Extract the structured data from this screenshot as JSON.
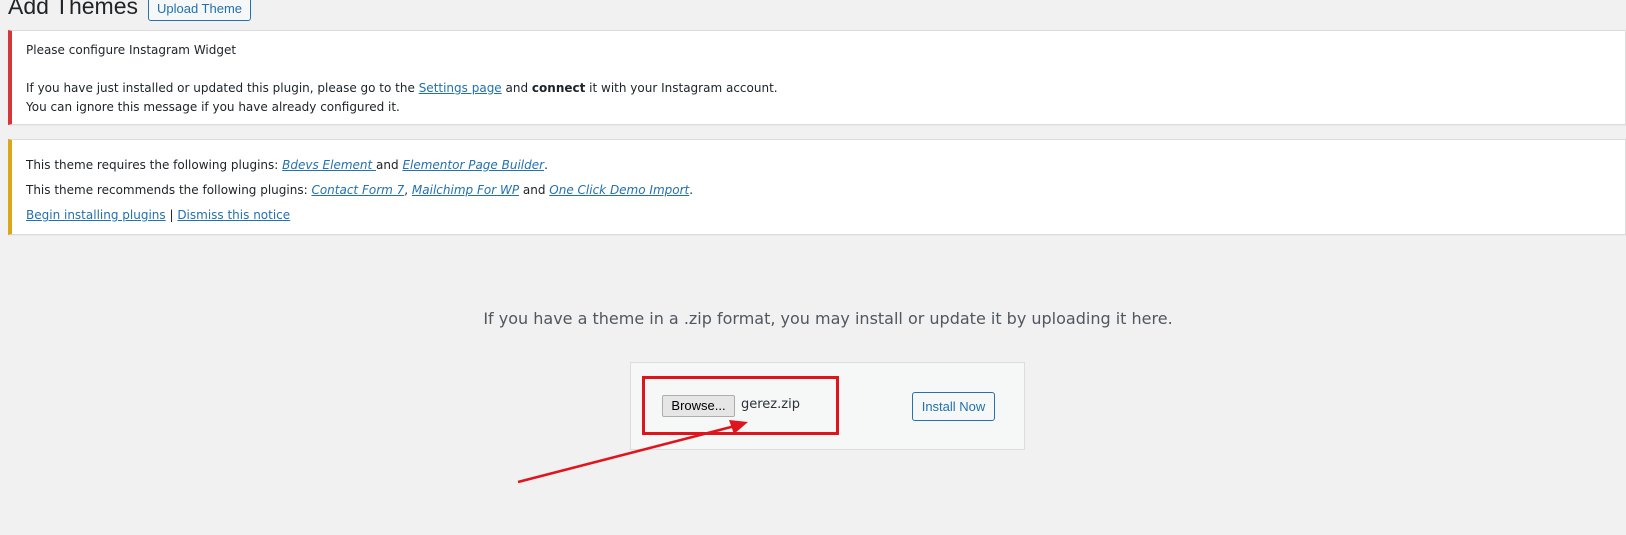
{
  "header": {
    "title": "Add Themes",
    "upload_button": "Upload Theme"
  },
  "instagram_notice": {
    "title": "Please configure Instagram Widget",
    "line1_before": "If you have just installed or updated this plugin, please go to the ",
    "settings_link": "Settings page",
    "line1_mid": " and ",
    "line1_bold": "connect",
    "line1_after": " it with your Instagram account.",
    "line2": "You can ignore this message if you have already configured it."
  },
  "plugin_notice": {
    "requires_prefix": "This theme requires the following plugins: ",
    "required": [
      "Bdevs Element ",
      "Elementor Page Builder"
    ],
    "requires_and": "and ",
    "recommends_prefix": "This theme recommends the following plugins: ",
    "recommended": [
      "Contact Form 7",
      "Mailchimp For WP",
      "One Click Demo Import"
    ],
    "begin_link": "Begin installing plugins",
    "separator": " | ",
    "dismiss_link": "Dismiss this notice"
  },
  "upload": {
    "description": "If you have a theme in a .zip format, you may install or update it by uploading it here.",
    "browse_label": "Browse...",
    "file_name": "gerez.zip",
    "install_label": "Install Now"
  },
  "colors": {
    "error_border": "#d63638",
    "warning_border": "#dba617",
    "link": "#2271b1",
    "annotation_red": "#e0141c"
  }
}
